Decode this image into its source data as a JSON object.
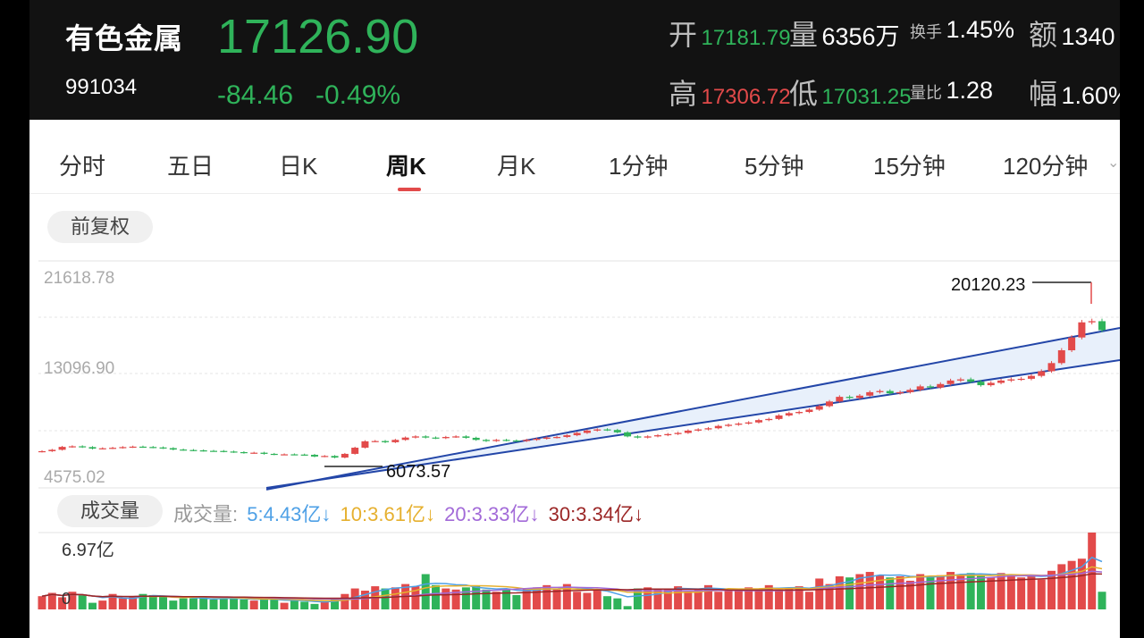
{
  "header": {
    "name": "有色金属",
    "code": "991034",
    "price": "17126.90",
    "change": "-84.46",
    "change_pct": "-0.49%",
    "stats": {
      "open_label": "开",
      "open_value": "17181.79",
      "volume_label": "量",
      "volume_value": "6356万",
      "turnover_label": "换手",
      "turnover_value": "1.45%",
      "amount_label": "额",
      "amount_value": "1340",
      "high_label": "高",
      "high_value": "17306.72",
      "low_label": "低",
      "low_value": "17031.25",
      "volratio_label": "量比",
      "volratio_value": "1.28",
      "amplitude_label": "幅",
      "amplitude_value": "1.60%"
    }
  },
  "tabs": [
    "分时",
    "五日",
    "日K",
    "周K",
    "月K",
    "1分钟",
    "5分钟",
    "15分钟",
    "120分钟"
  ],
  "active_tab": "周K",
  "adjust_label": "前复权",
  "price_axis": {
    "top": "21618.78",
    "mid": "13096.90",
    "bottom": "4575.02"
  },
  "annotations": {
    "high": "20120.23",
    "low": "6073.57"
  },
  "volume_panel": {
    "label": "成交量",
    "legend_prefix": "成交量:",
    "ma5": "5:4.43亿↓",
    "ma10": "10:3.61亿↓",
    "ma20": "20:3.33亿↓",
    "ma30": "30:3.34亿↓",
    "max_label": "6.97亿",
    "zero_label": "0"
  },
  "colors": {
    "up": "#e24a4a",
    "down": "#2fb35a",
    "channel": "#2346a8",
    "ma5": "#4ea0e6",
    "ma10": "#e6b02f",
    "ma20": "#a26ad8",
    "ma30": "#9b2626"
  },
  "chart_data": {
    "type": "candlestick",
    "period": "weekly",
    "ylim": [
      4575.02,
      21618.78
    ],
    "closes": [
      6730,
      6850,
      7100,
      7150,
      7080,
      6950,
      6980,
      7020,
      7080,
      7120,
      7090,
      7050,
      6990,
      6870,
      6830,
      6800,
      6760,
      6750,
      6700,
      6650,
      6580,
      6600,
      6500,
      6450,
      6460,
      6440,
      6420,
      6270,
      6320,
      6180,
      6500,
      7030,
      7580,
      7600,
      7500,
      7700,
      7900,
      8000,
      7900,
      7850,
      7950,
      8000,
      7880,
      7700,
      7600,
      7700,
      7650,
      7600,
      7700,
      7800,
      7900,
      7950,
      8100,
      8300,
      8500,
      8600,
      8550,
      8350,
      8000,
      7900,
      8000,
      8100,
      8200,
      8300,
      8500,
      8600,
      8700,
      8900,
      9000,
      9100,
      9200,
      9400,
      9500,
      9800,
      10000,
      10100,
      10300,
      10600,
      11000,
      11400,
      11300,
      11500,
      11800,
      11900,
      11700,
      11800,
      12000,
      12300,
      12200,
      12500,
      12800,
      12900,
      12700,
      12400,
      12600,
      12800,
      12900,
      12950,
      13200,
      13600,
      14300,
      15400,
      16500,
      17800,
      17900,
      17126.9
    ],
    "volume_ylim": [
      0,
      6.97
    ],
    "volumes": [
      1.2,
      1.5,
      1.1,
      1.6,
      1.3,
      0.6,
      0.8,
      1.4,
      1.0,
      1.2,
      1.4,
      1.3,
      1.2,
      0.8,
      1.0,
      1.0,
      1.1,
      0.9,
      1.0,
      1.0,
      0.9,
      0.8,
      0.9,
      1.0,
      0.6,
      0.8,
      0.7,
      0.5,
      0.8,
      0.9,
      1.4,
      1.9,
      1.7,
      2.1,
      1.9,
      2.0,
      2.3,
      2.1,
      3.2,
      2.2,
      1.9,
      1.8,
      2.0,
      2.1,
      1.8,
      1.6,
      1.9,
      1.3,
      1.9,
      2.0,
      2.2,
      1.8,
      2.3,
      1.6,
      1.5,
      1.7,
      1.2,
      1.0,
      0.3,
      1.9,
      2.0,
      1.8,
      1.8,
      2.1,
      1.7,
      1.9,
      2.2,
      1.6,
      1.8,
      1.7,
      2.0,
      1.9,
      2.2,
      1.8,
      1.9,
      2.1,
      1.6,
      2.8,
      2.3,
      3.0,
      2.9,
      3.2,
      3.4,
      3.1,
      2.9,
      3.0,
      2.6,
      3.2,
      3.0,
      3.1,
      3.4,
      3.2,
      3.3,
      3.1,
      2.9,
      3.3,
      3.1,
      2.9,
      3.0,
      2.7,
      3.5,
      4.1,
      4.4,
      4.6,
      6.97,
      1.6
    ]
  }
}
